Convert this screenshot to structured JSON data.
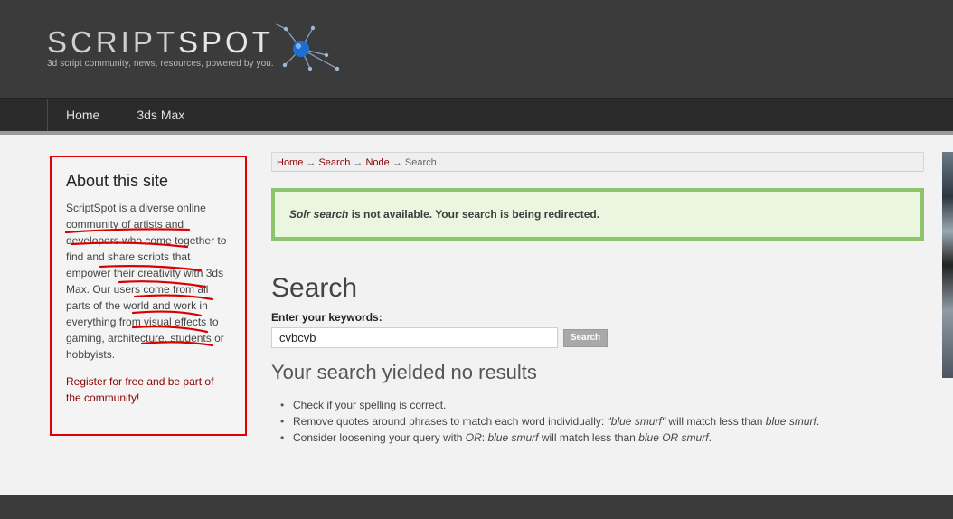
{
  "header": {
    "logo_part1": "SCRIPT",
    "logo_part2": "SPOT",
    "tagline": "3d script community, news, resources, powered by you."
  },
  "nav": {
    "items": [
      {
        "label": "Home"
      },
      {
        "label": "3ds Max"
      }
    ]
  },
  "sidebar": {
    "title": "About this site",
    "body": "ScriptSpot is a diverse online community of artists and developers who come together to find and share scripts that empower their creativity with 3ds Max. Our users come from all parts of the world and work in everything from visual effects to gaming, architecture, students or hobbyists.",
    "register_text": "Register for free and be part of the community!"
  },
  "breadcrumb": {
    "items": [
      "Home",
      "Search",
      "Node"
    ],
    "separator": "→",
    "current": "Search"
  },
  "message": {
    "highlight": "Solr search",
    "text": " is not available. Your search is being redirected."
  },
  "search": {
    "title": "Search",
    "label": "Enter your keywords:",
    "value": "cvbcvb",
    "button_label": "Search"
  },
  "results": {
    "heading": "Your search yielded no results",
    "tip1": "Check if your spelling is correct.",
    "tip2_a": "Remove quotes around phrases to match each word individually: ",
    "tip2_b": "\"blue smurf\"",
    "tip2_c": " will match less than ",
    "tip2_d": "blue smurf",
    "tip2_e": ".",
    "tip3_a": "Consider loosening your query with ",
    "tip3_b": "OR",
    "tip3_c": ": ",
    "tip3_d": "blue smurf",
    "tip3_e": " will match less than ",
    "tip3_f": "blue OR smurf",
    "tip3_g": "."
  },
  "colors": {
    "header_bg": "#3b3b3b",
    "nav_bg": "#2b2b2b",
    "link": "#8b0000",
    "highlight_border": "#e00000",
    "message_border": "#8cc36b",
    "message_bg": "#eaf6df"
  }
}
